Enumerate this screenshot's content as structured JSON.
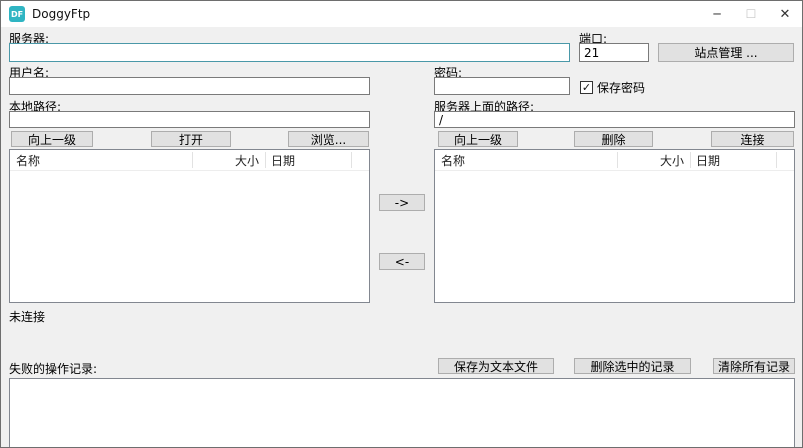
{
  "window": {
    "title": "DoggyFtp",
    "icon_text": "DF"
  },
  "icons": {
    "minimize": "─",
    "maximize": "☐",
    "close": "✕",
    "checkmark": "✓"
  },
  "connection": {
    "server_label": "服务器:",
    "server_value": "",
    "port_label": "端口:",
    "port_value": "21",
    "site_manager_button": "站点管理 ...",
    "username_label": "用户名:",
    "username_value": "",
    "password_label": "密码:",
    "password_value": "",
    "save_password_label": "保存密码",
    "save_password_checked": true
  },
  "local_panel": {
    "path_label": "本地路径:",
    "path_value": "",
    "up_button": "向上一级",
    "open_button": "打开",
    "browse_button": "浏览...",
    "columns": [
      "名称",
      "大小",
      "日期"
    ],
    "rows": []
  },
  "remote_panel": {
    "path_label": "服务器上面的路径:",
    "path_value": "/",
    "up_button": "向上一级",
    "delete_button": "删除",
    "connect_button": "连接",
    "columns": [
      "名称",
      "大小",
      "日期"
    ],
    "rows": []
  },
  "transfer": {
    "upload_button": "->",
    "download_button": "<-"
  },
  "status": {
    "text": "未连接"
  },
  "log": {
    "label": "失败的操作记录:",
    "save_button": "保存为文本文件",
    "delete_selected_button": "删除选中的记录",
    "clear_all_button": "清除所有记录",
    "entries": []
  },
  "colors": {
    "accent_teal": "#2fb5c3",
    "focused_input_border": "#4a98a8",
    "window_bg": "#f0f0f0",
    "titlebar_bg": "#ffffff",
    "button_bg": "#e1e1e1"
  }
}
